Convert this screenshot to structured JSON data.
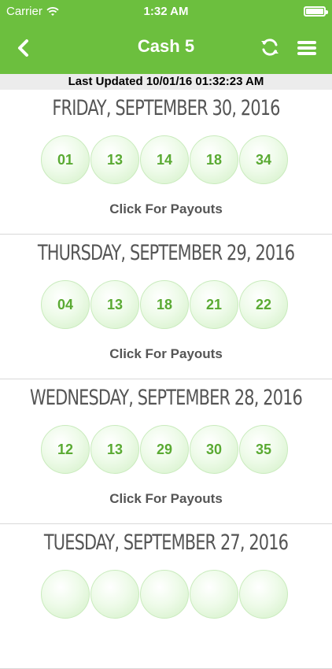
{
  "status_bar": {
    "carrier": "Carrier",
    "time": "1:32 AM"
  },
  "header": {
    "title": "Cash 5",
    "back_icon": "chevron-left-icon",
    "refresh_icon": "refresh-icon",
    "menu_icon": "hamburger-menu-icon"
  },
  "last_updated": "Last Updated 10/01/16 01:32:23 AM",
  "draws": [
    {
      "date": "FRIDAY, SEPTEMBER 30, 2016",
      "numbers": [
        "01",
        "13",
        "14",
        "18",
        "34"
      ],
      "payout_label": "Click For Payouts"
    },
    {
      "date": "THURSDAY, SEPTEMBER 29, 2016",
      "numbers": [
        "04",
        "13",
        "18",
        "21",
        "22"
      ],
      "payout_label": "Click For Payouts"
    },
    {
      "date": "WEDNESDAY, SEPTEMBER 28, 2016",
      "numbers": [
        "12",
        "13",
        "29",
        "30",
        "35"
      ],
      "payout_label": "Click For Payouts"
    },
    {
      "date": "TUESDAY, SEPTEMBER 27, 2016",
      "numbers": [],
      "payout_label": ""
    }
  ],
  "colors": {
    "brand_green": "#6cbf3e",
    "ball_text": "#5aaa33"
  }
}
